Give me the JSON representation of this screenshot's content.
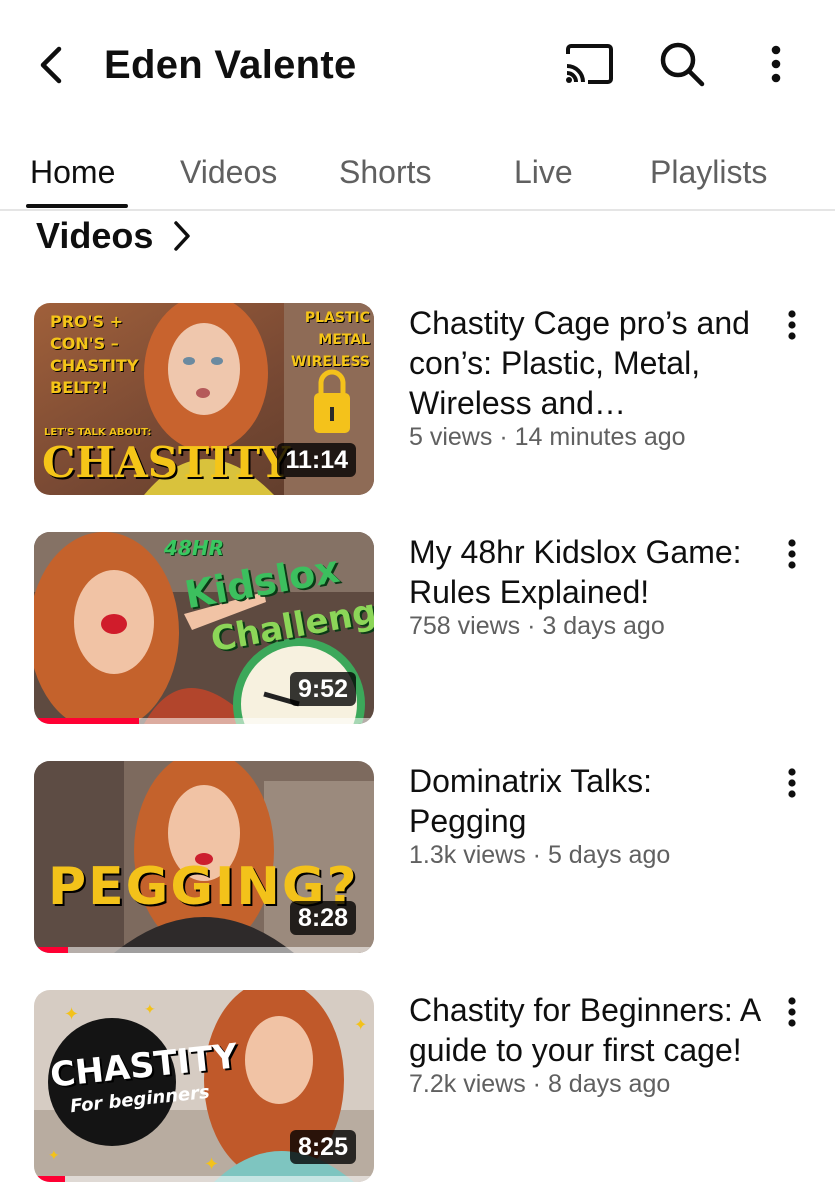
{
  "header": {
    "title": "Eden Valente",
    "icons": {
      "back": "back-arrow-icon",
      "cast": "cast-icon",
      "search": "search-icon",
      "more": "more-vertical-icon"
    }
  },
  "tabs": [
    {
      "label": "Home",
      "active": true
    },
    {
      "label": "Videos",
      "active": false
    },
    {
      "label": "Shorts",
      "active": false
    },
    {
      "label": "Live",
      "active": false
    },
    {
      "label": "Playlists",
      "active": false
    }
  ],
  "section": {
    "title": "Videos"
  },
  "videos": [
    {
      "title": "Chastity Cage pro’s and con’s: Plastic, Metal, Wireless and…",
      "views": "5 views",
      "age": "14 minutes ago",
      "duration": "11:14",
      "watched_fraction": 0,
      "thumb_text": {
        "left_lines": [
          "PRO'S +",
          "CON'S –",
          "CHASTITY",
          "BELT?!"
        ],
        "small": "LET'S TALK ABOUT:",
        "big": "CHASTITY",
        "right_lines": [
          "PLASTIC",
          "METAL",
          "WIRELESS"
        ]
      }
    },
    {
      "title": "My 48hr Kidslox Game: Rules Explained!",
      "views": "758 views",
      "age": "3 days ago",
      "duration": "9:52",
      "watched_fraction": 0.31,
      "thumb_text": {
        "top": "48HR",
        "line1": "Kidslox",
        "line2": "Challenge"
      }
    },
    {
      "title": "Dominatrix Talks: Pegging",
      "views": "1.3k views",
      "age": "5 days ago",
      "duration": "8:28",
      "watched_fraction": 0.1,
      "thumb_text": {
        "big": "PEGGING?"
      }
    },
    {
      "title": "Chastity for Beginners: A guide to your first cage!",
      "views": "7.2k views",
      "age": "8 days ago",
      "duration": "8:25",
      "watched_fraction": 0.09,
      "thumb_text": {
        "line1": "CHASTITY",
        "line2": "For beginners"
      }
    }
  ],
  "separator": "·",
  "colors": {
    "accent": "#ff0033",
    "text": "#0f0f0f",
    "secondary": "#606060",
    "divider": "#e5e5e5"
  }
}
